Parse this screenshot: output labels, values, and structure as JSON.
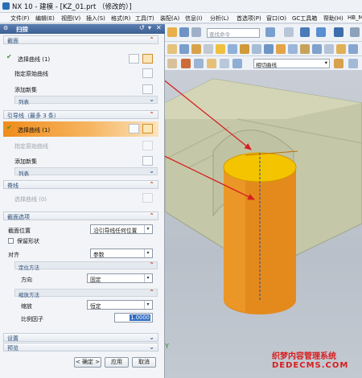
{
  "window": {
    "title": "NX 10 - 建模 - [KZ_01.prt （修改的）]"
  },
  "menu": [
    "文件(F)",
    "编辑(E)",
    "视图(V)",
    "插入(S)",
    "格式(R)",
    "工具(T)",
    "装配(A)",
    "信息(I)",
    "分析(L)",
    "首选项(P)",
    "窗口(O)",
    "GC工具箱",
    "帮助(H)",
    "HB_M"
  ],
  "toolbar": {
    "search_placeholder": "查找命令",
    "left_combo": "没有",
    "curve_rule": "相切曲线"
  },
  "dialog": {
    "title": "扫掠",
    "section_profile": {
      "header": "截面",
      "select_curve": "选择曲线 (1)",
      "specify_origin": "指定原始曲线",
      "add_new_set": "添加新集",
      "list": "列表"
    },
    "section_guide": {
      "header": "引导线（最多 3 条）",
      "select_curve": "选择曲线 (1)",
      "specify_origin": "指定原始曲线",
      "add_new_set": "添加新集",
      "list": "列表"
    },
    "section_spine": {
      "header": "脊线",
      "select_curve": "选择曲线 (0)"
    },
    "section_options": {
      "header": "截面选项",
      "position_label": "截面位置",
      "position_value": "沿引导线任何位置",
      "preserve_shape": "保留形状",
      "align_label": "对齐",
      "align_value": "参数",
      "orientation_header": "定位方法",
      "direction_label": "方向",
      "direction_value": "固定",
      "scaling_header": "缩放方法",
      "scale_label": "缩放",
      "scale_value": "恒定",
      "ratio_label": "比例因子",
      "ratio_value": "1.0000"
    },
    "settings": "设置",
    "preview": "预览",
    "ok": "< 确定 >",
    "apply": "应用",
    "cancel": "取消"
  },
  "viewport": {
    "axis_label": "Y"
  },
  "watermark": {
    "line1": "织梦内容管理系统",
    "line2": "DEDECMS.COM"
  },
  "colors": {
    "accent": "#f0a030",
    "cylinder_side": "#e48a1c",
    "cylinder_top": "#f4c400",
    "title_bar": "#3d5f93",
    "arrow": "#d62020"
  }
}
